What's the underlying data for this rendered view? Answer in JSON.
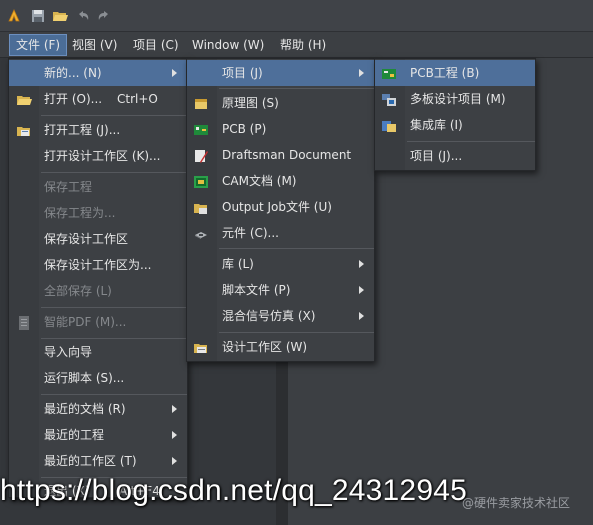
{
  "toolbar": {
    "icons": [
      "altium-logo-icon",
      "save-icon",
      "open-folder-icon",
      "undo-icon",
      "redo-icon"
    ]
  },
  "menubar": {
    "items": [
      {
        "label": "文件 (F)",
        "active": true
      },
      {
        "label": "视图 (V)",
        "active": false
      },
      {
        "label": "项目 (C)",
        "active": false
      },
      {
        "label": "Window (W)",
        "active": false
      },
      {
        "label": "帮助 (H)",
        "active": false
      }
    ]
  },
  "file_menu": {
    "new": "新的... (N)",
    "open": "打开 (O)...",
    "open_shortcut": "Ctrl+O",
    "open_project": "打开工程 (J)...",
    "open_workspace": "打开设计工作区 (K)...",
    "save_project": "保存工程",
    "save_project_as": "保存工程为...",
    "save_workspace": "保存设计工作区",
    "save_workspace_as": "保存设计工作区为...",
    "save_all": "全部保存 (L)",
    "smart_pdf": "智能PDF (M)...",
    "import_wizard": "导入向导",
    "run_script": "运行脚本 (S)...",
    "recent_docs": "最近的文档 (R)",
    "recent_projects": "最近的工程",
    "recent_workspaces": "最近的工作区 (T)",
    "exit_partial": "退出 (X)",
    "exit_shortcut": "Alt+F4"
  },
  "new_menu": {
    "project": "项目 (J)",
    "schematic": "原理图 (S)",
    "pcb": "PCB (P)",
    "draftsman": "Draftsman Document",
    "cam": "CAM文档 (M)",
    "output_job": "Output Job文件 (U)",
    "component": "元件 (C)...",
    "library": "库 (L)",
    "script_file": "脚本文件 (P)",
    "mixed_sim": "混合信号仿真 (X)",
    "design_workspace": "设计工作区 (W)"
  },
  "project_menu": {
    "pcb_project": "PCB工程 (B)",
    "multiboard": "多板设计项目 (M)",
    "integrated_lib": "集成库 (I)",
    "project_ellipsis": "项目 (J)..."
  },
  "watermark": {
    "url": "https://blog.csdn.net/qq_24312945",
    "sub": "@硬件卖家技术社区"
  },
  "colors": {
    "highlight": "#4e6f9a",
    "menu_bg": "#3d4044",
    "disabled_text": "#85888c"
  }
}
